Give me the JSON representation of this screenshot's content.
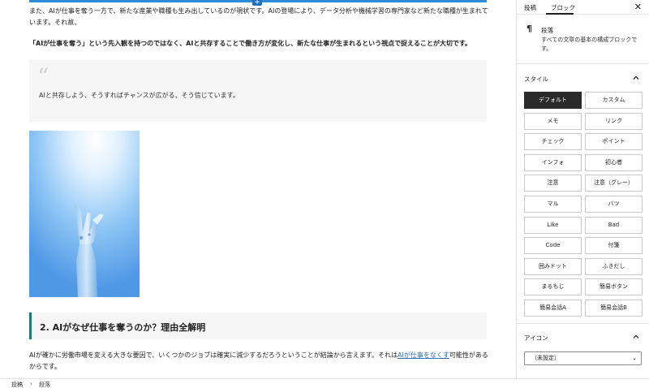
{
  "editor": {
    "para1": "また、AIが仕事を奪う一方で、新たな産業や職種も生み出しているのが現状です。AIの登場により、データ分析や機械学習の専門家など新たな職種が生まれています。それ故、",
    "para2": "「AIが仕事を奪う」という先入観を持つのではなく、AIと共存することで働き方が変化し、新たな仕事が生まれるという視点で捉えることが大切です。",
    "quote_mark": "“",
    "quote": "AIと共存しよう、そうすればチャンスが広がる、そう信じています。",
    "inserter": "+",
    "heading": "2. AIがなぜ仕事を奪うのか？理由全解明",
    "para3_before": "AIが確かに労働市場を変える大きな要因で、いくつかのジョブは確実に減少するだろうということが結論から言えます。それは",
    "para3_link": "AIが仕事をなくす",
    "para3_after": "可能性があるからです。"
  },
  "breadcrumb": {
    "root": "投稿",
    "sep": "›",
    "current": "段落"
  },
  "sidebar": {
    "tab_post": "投稿",
    "tab_block": "ブロック",
    "close": "✕",
    "block_icon": "¶",
    "block_title": "段落",
    "block_desc": "すべての文章の基本の構成ブロックです。",
    "style_title": "スタイル",
    "styles": [
      {
        "label": "デフォルト",
        "active": true
      },
      {
        "label": "カスタム",
        "active": false
      },
      {
        "label": "メモ",
        "active": false
      },
      {
        "label": "リンク",
        "active": false
      },
      {
        "label": "チェック",
        "active": false
      },
      {
        "label": "ポイント",
        "active": false
      },
      {
        "label": "インフォ",
        "active": false
      },
      {
        "label": "初心者",
        "active": false
      },
      {
        "label": "注意",
        "active": false
      },
      {
        "label": "注意（グレー）",
        "active": false
      },
      {
        "label": "マル",
        "active": false
      },
      {
        "label": "バツ",
        "active": false
      },
      {
        "label": "Like",
        "active": false
      },
      {
        "label": "Bad",
        "active": false
      },
      {
        "label": "Code",
        "active": false
      },
      {
        "label": "付箋",
        "active": false
      },
      {
        "label": "囲みドット",
        "active": false
      },
      {
        "label": "ふきだし",
        "active": false
      },
      {
        "label": "まるもじ",
        "active": false
      },
      {
        "label": "簡易ボタン",
        "active": false
      },
      {
        "label": "簡易会話A",
        "active": false
      },
      {
        "label": "簡易会話B",
        "active": false
      }
    ],
    "icon_title": "アイコン",
    "icon_select": "（未設定）",
    "select_arrow": "⌄"
  },
  "colors": {
    "accent_blue": "#2d8bd7",
    "heading_border": "#1f7b6f",
    "active_style": "#2a2a2a",
    "link": "#2b6cb0"
  }
}
